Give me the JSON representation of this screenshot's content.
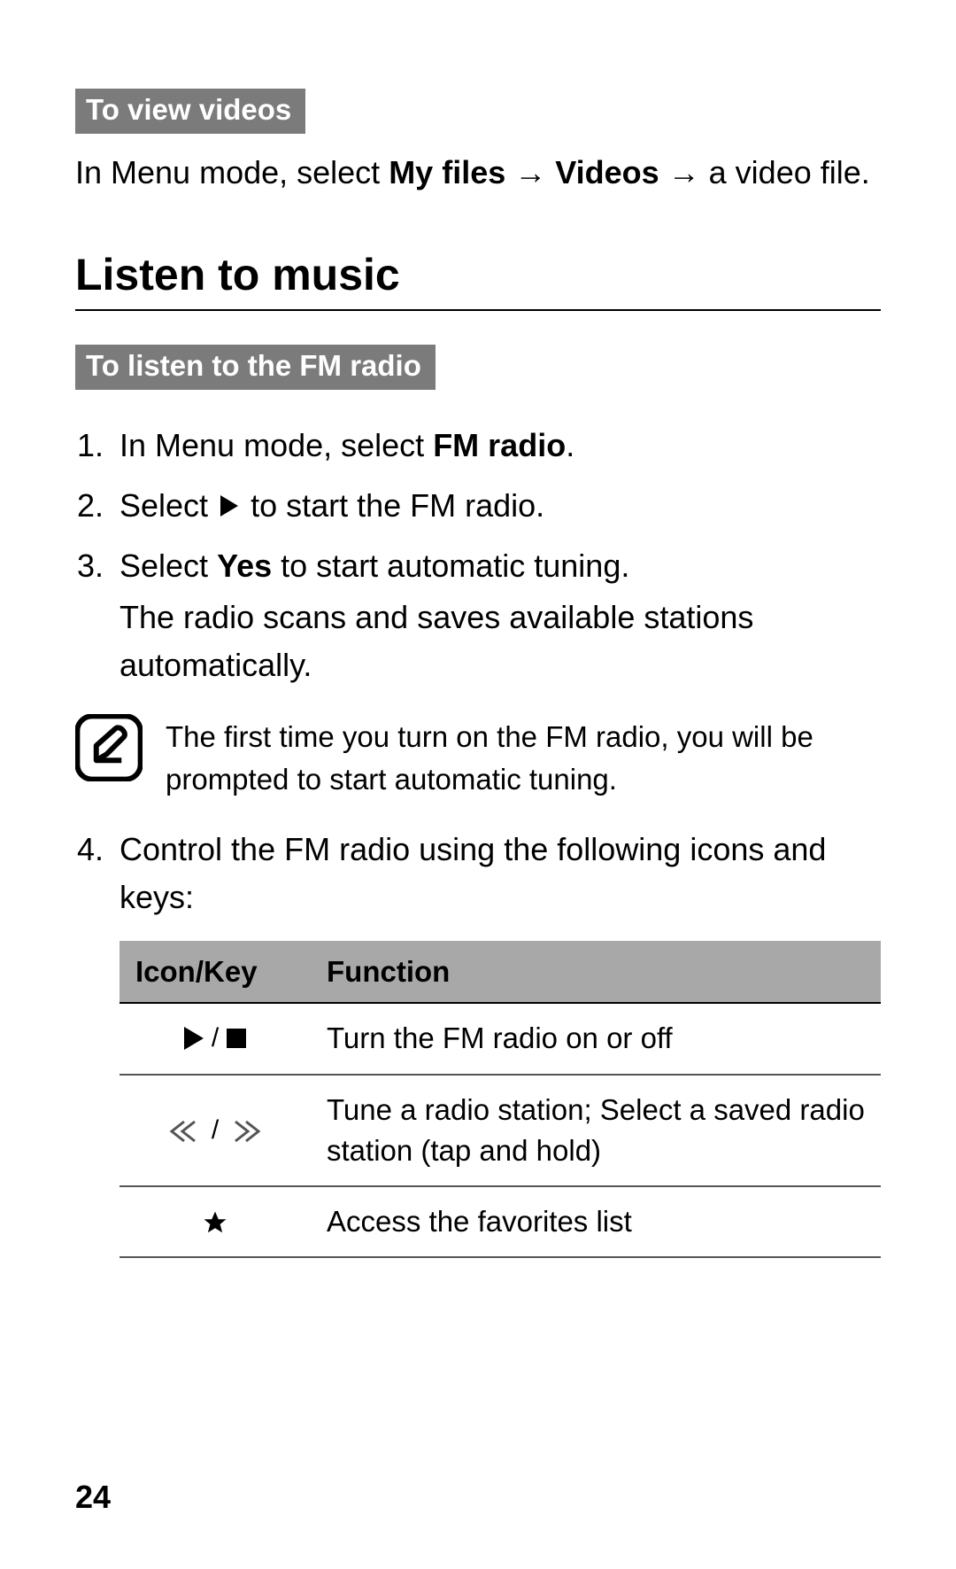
{
  "section_videos": {
    "tag": "To view videos",
    "para_pre": "In Menu mode, select ",
    "para_b1": "My files",
    "para_arrow1": " → ",
    "para_b2": "Videos",
    "para_arrow2": " → ",
    "para_tail": "a video file."
  },
  "section_music_heading": "Listen to music",
  "section_fm": {
    "tag": "To listen to the FM radio",
    "steps": {
      "s1_pre": "In Menu mode, select ",
      "s1_b": "FM radio",
      "s1_post": ".",
      "s2_pre": "Select ",
      "s2_post": " to start the FM radio.",
      "s3_pre": "Select ",
      "s3_b": "Yes",
      "s3_post": " to start automatic tuning.",
      "s3_sub": "The radio scans and saves available stations automatically.",
      "s4": "Control the FM radio using the following icons and keys:"
    }
  },
  "note_text": "The first time you turn on the FM radio, you will be prompted to start automatic tuning.",
  "table": {
    "head_icon": "Icon/Key",
    "head_fn": "Function",
    "rows": [
      {
        "fn": "Turn the FM radio on or off"
      },
      {
        "fn": "Tune a radio station; Select a saved radio station (tap and hold)"
      },
      {
        "fn": "Access the favorites list"
      }
    ]
  },
  "page_number": "24"
}
